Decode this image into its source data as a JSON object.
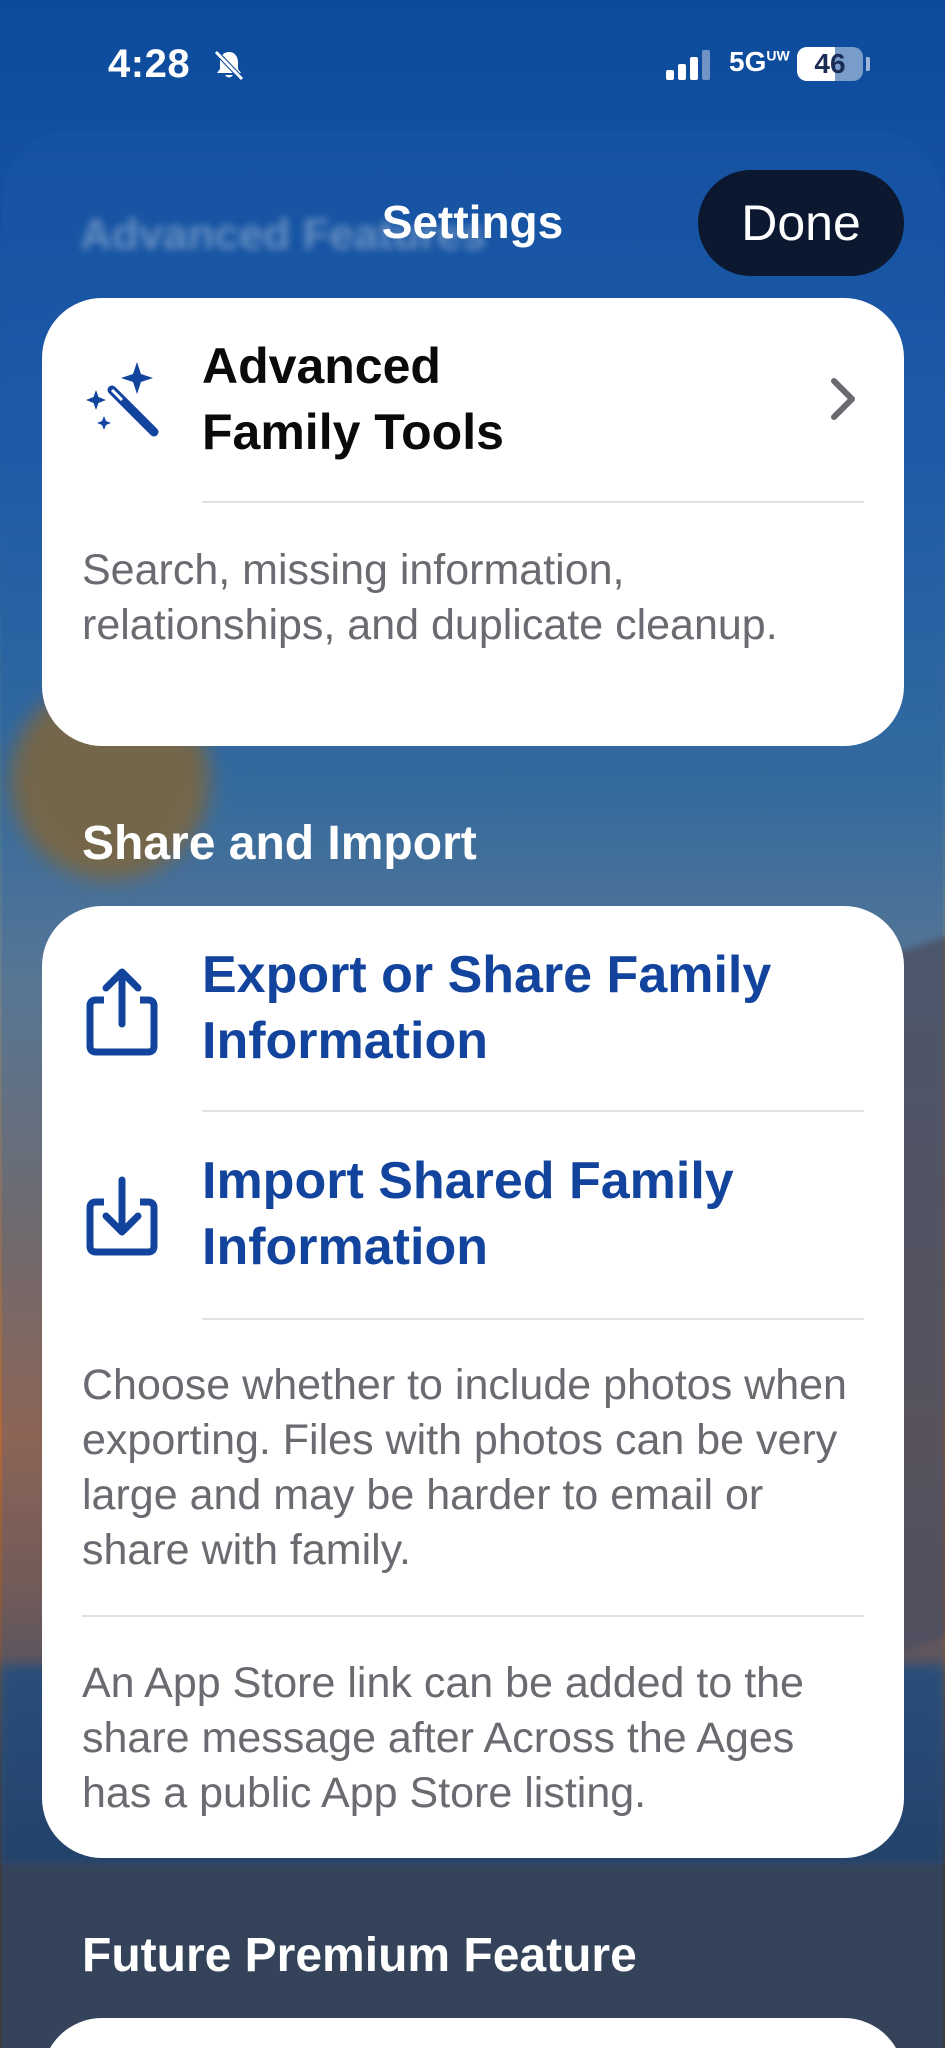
{
  "status_bar": {
    "time": "4:28",
    "network": "5G",
    "network_suffix": "UW",
    "battery": "46"
  },
  "nav": {
    "ghost_title": "Advanced Features",
    "title": "Settings",
    "done_label": "Done"
  },
  "advanced_card": {
    "title_line1": "Advanced",
    "title_line2": "Family Tools",
    "description": "Search, missing information, relationships, and duplicate cleanup."
  },
  "share_section": {
    "header": "Share and Import",
    "export_line1": "Export or Share Family",
    "export_line2": "Information",
    "import_line1": "Import Shared Family",
    "import_line2": "Information",
    "photos_note": "Choose whether to include photos when exporting. Files with photos can be very large and may be harder to email or share with family.",
    "app_store_note": "An App Store link can be added to the share message after Across the Ages has a public App Store listing."
  },
  "premium_section": {
    "header": "Future Premium Feature"
  },
  "colors": {
    "accent_blue": "#12449e",
    "done_bg": "#0b1830"
  }
}
